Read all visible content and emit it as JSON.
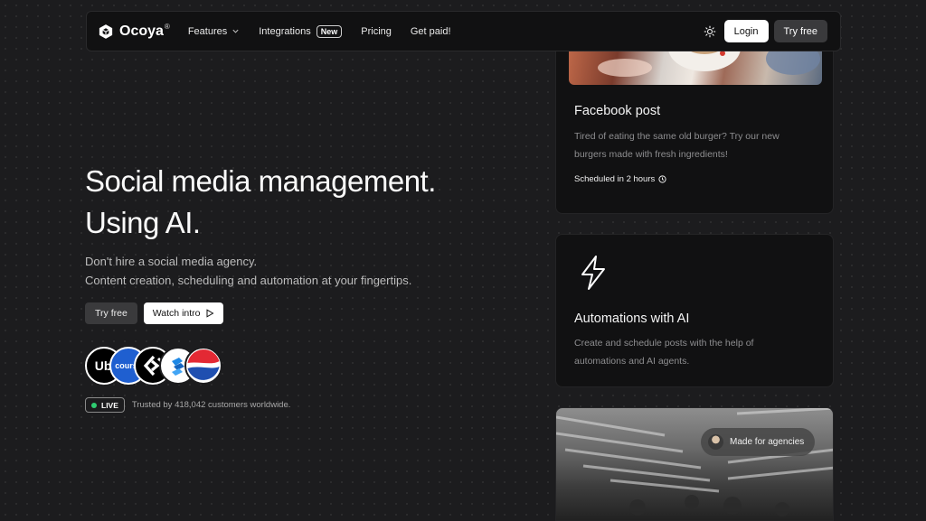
{
  "brand": {
    "name": "Ocoya",
    "reg_mark": "®"
  },
  "nav": {
    "items": [
      {
        "label": "Features",
        "has_dropdown": true
      },
      {
        "label": "Integrations",
        "badge": "New"
      },
      {
        "label": "Pricing"
      },
      {
        "label": "Get paid!"
      }
    ],
    "login_label": "Login",
    "try_label": "Try free",
    "theme_icon": "sun-icon"
  },
  "hero": {
    "title_line1": "Social media management.",
    "title_line2": "Using AI.",
    "sub_line1": "Don't hire a social media agency.",
    "sub_line2": "Content creation, scheduling and automation at your fingertips.",
    "try_label": "Try free",
    "watch_label": "Watch intro",
    "customer_logos": [
      {
        "name": "uber-logo",
        "text": "Ube"
      },
      {
        "name": "coursera-logo",
        "text": "course"
      },
      {
        "name": "arrow-brand-logo"
      },
      {
        "name": "blue-brand-logo"
      },
      {
        "name": "pepsi-logo"
      }
    ],
    "live_label": "LIVE",
    "trusted_text": "Trusted by 418,042 customers worldwide."
  },
  "cards": {
    "facebook": {
      "title": "Facebook post",
      "text": "Tired of eating the same old burger? Try our new burgers made with fresh ingredients!",
      "scheduled": "Scheduled in 2 hours"
    },
    "automations": {
      "title": "Automations with AI",
      "text": "Create and schedule posts with the help of automations and AI agents."
    },
    "agencies": {
      "pill_label": "Made for agencies"
    }
  },
  "colors": {
    "background": "#1c1c1e",
    "card": "#111112",
    "live_dot": "#2ecc71",
    "coursera_blue": "#1f5fd0",
    "pepsi_red": "#e32934",
    "pepsi_blue": "#1f4fb0"
  }
}
